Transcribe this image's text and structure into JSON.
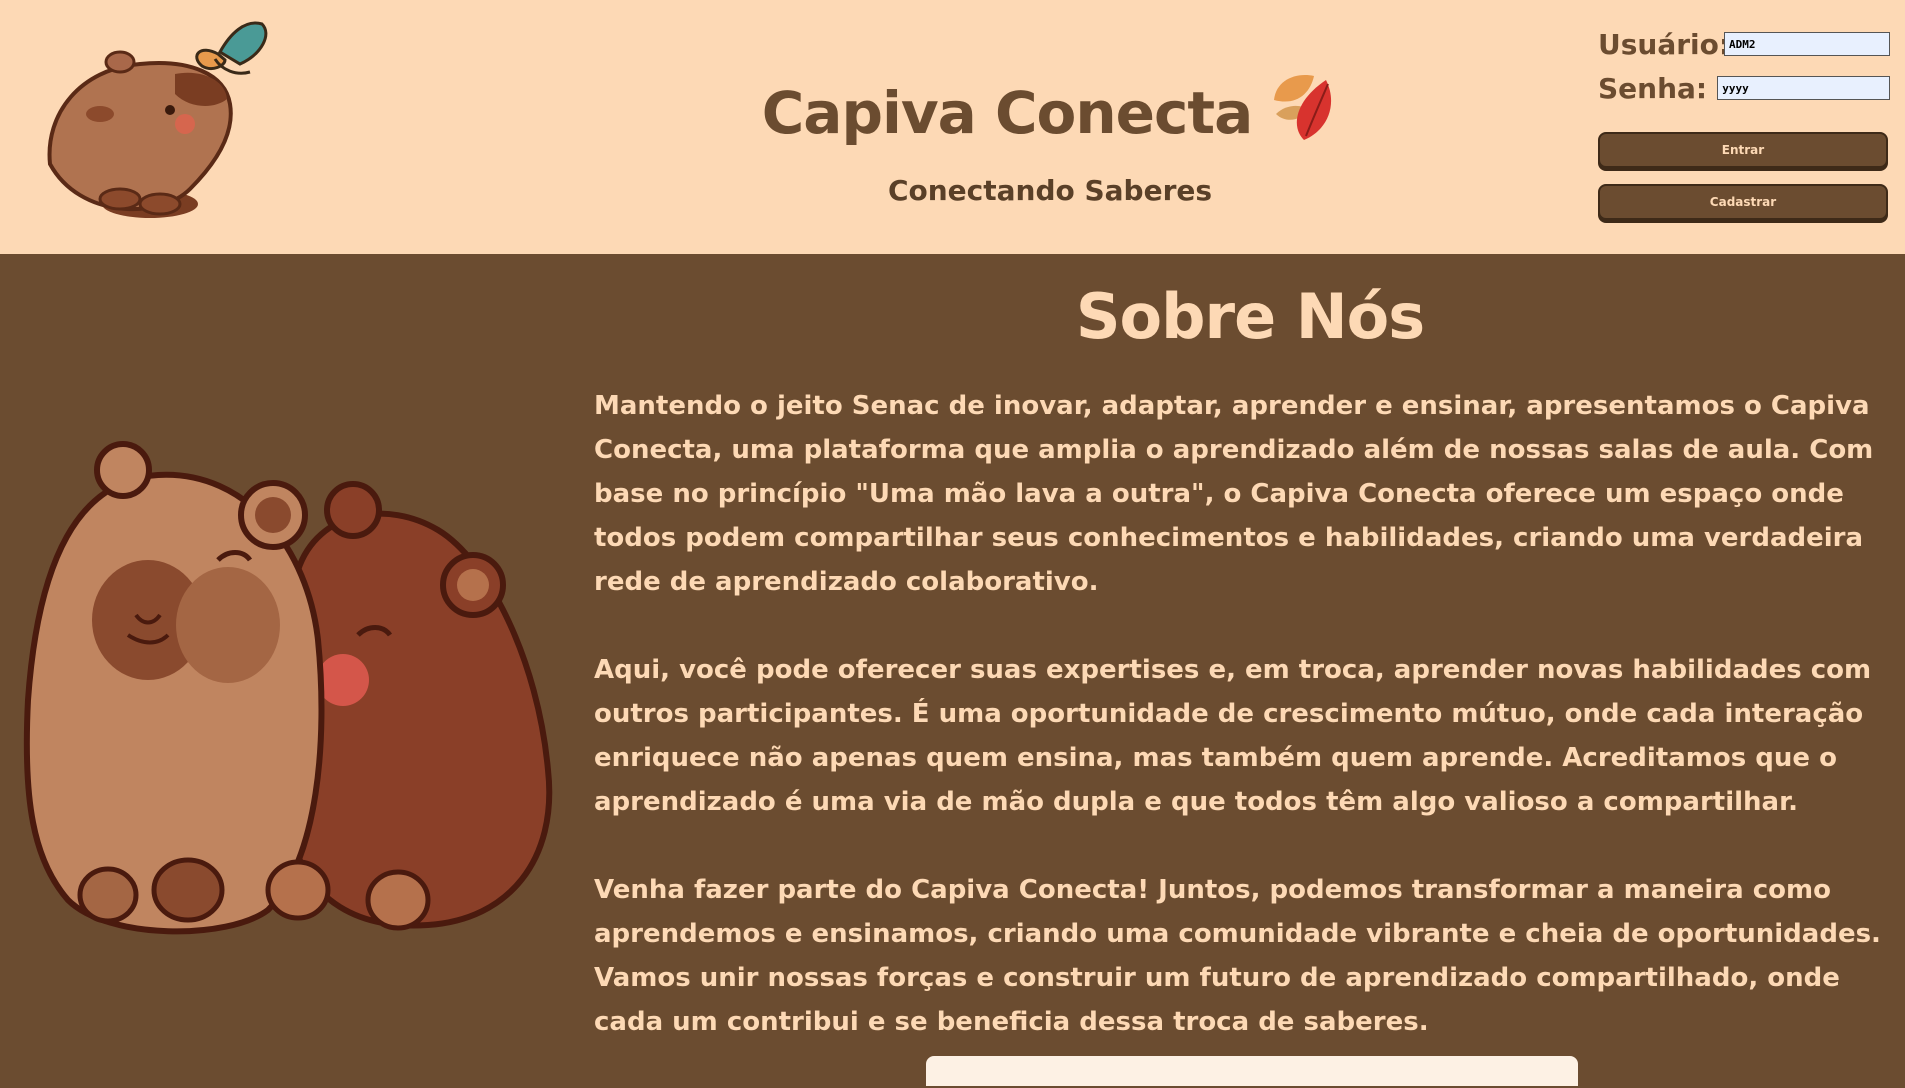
{
  "header": {
    "brand_title": "Capiva Conecta",
    "brand_subtitle": "Conectando Saberes"
  },
  "login": {
    "user_label": "Usuário:",
    "user_value": "ADM2",
    "password_label": "Senha:",
    "password_value": "yyyy",
    "enter_button": "Entrar",
    "register_button": "Cadastrar"
  },
  "about": {
    "title": "Sobre Nós",
    "paragraphs": [
      "Mantendo o jeito Senac de inovar, adaptar, aprender e ensinar, apresentamos o Capiva Conecta, uma plataforma que amplia o aprendizado além de nossas salas de aula. Com base no princípio \"Uma mão lava a outra\", o Capiva Conecta oferece um espaço onde todos podem compartilhar seus conhecimentos e habilidades, criando uma verdadeira rede de aprendizado colaborativo.",
      "Aqui, você pode oferecer suas expertises e, em troca, aprender novas habilidades com outros participantes. É uma oportunidade de crescimento mútuo, onde cada interação enriquece não apenas quem ensina, mas também quem aprende. Acreditamos que o aprendizado é uma via de mão dupla e que todos têm algo valioso a compartilhar.",
      "Venha fazer parte do Capiva Conecta! Juntos, podemos transformar a maneira como aprendemos e ensinamos, criando uma comunidade vibrante e cheia de oportunidades. Vamos unir nossas forças e construir um futuro de aprendizado compartilhado, onde cada um contribui e se beneficia dessa troca de saberes."
    ]
  },
  "colors": {
    "header_bg": "#fdd9b5",
    "page_bg": "#6b4c30",
    "accent_text": "#fdd9b5",
    "dark_brown": "#6b4c30"
  },
  "icons": {
    "logo": "capybara-with-butterfly-icon",
    "leaves": "autumn-leaves-icon",
    "hero": "two-capybaras-hugging-illustration"
  }
}
